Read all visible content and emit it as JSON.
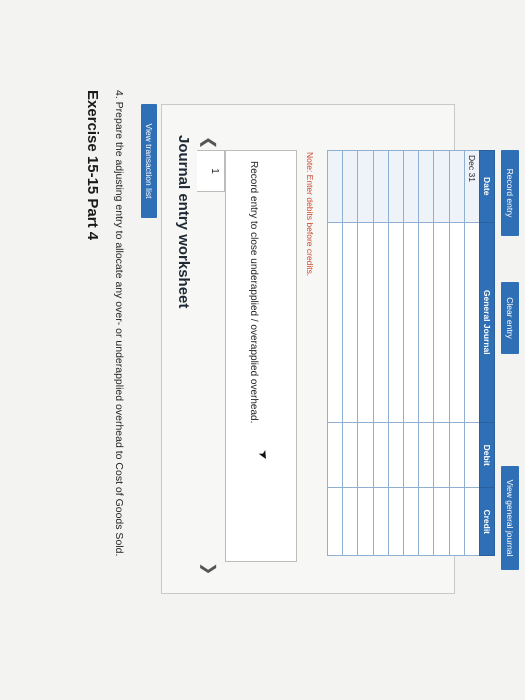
{
  "exercise": {
    "title": "Exercise 15-15 Part 4",
    "instruction": "4. Prepare the adjusting entry to allocate any over- or underapplied overhead to Cost of Goods Sold."
  },
  "buttons": {
    "view_transaction_list": "View transaction list",
    "record_entry": "Record entry",
    "clear_entry": "Clear entry",
    "view_general_journal": "View general journal"
  },
  "worksheet": {
    "title": "Journal entry worksheet",
    "prev_icon": "chevron-left-icon",
    "next_icon": "chevron-right-icon",
    "tab_number": "1",
    "record_text": "Record entry to close underapplied / overapplied overhead.",
    "note": "Note: Enter debits before credits."
  },
  "table": {
    "headers": [
      "Date",
      "General Journal",
      "Debit",
      "Credit"
    ],
    "rows": [
      [
        "Dec 31",
        "",
        "",
        ""
      ],
      [
        "",
        "",
        "",
        ""
      ],
      [
        "",
        "",
        "",
        ""
      ],
      [
        "",
        "",
        "",
        ""
      ],
      [
        "",
        "",
        "",
        ""
      ],
      [
        "",
        "",
        "",
        ""
      ],
      [
        "",
        "",
        "",
        ""
      ],
      [
        "",
        "",
        "",
        ""
      ],
      [
        "",
        "",
        "",
        ""
      ],
      [
        "",
        "",
        "",
        ""
      ]
    ]
  },
  "colors": {
    "accent": "#2f6fb5",
    "note": "#c9452c"
  }
}
